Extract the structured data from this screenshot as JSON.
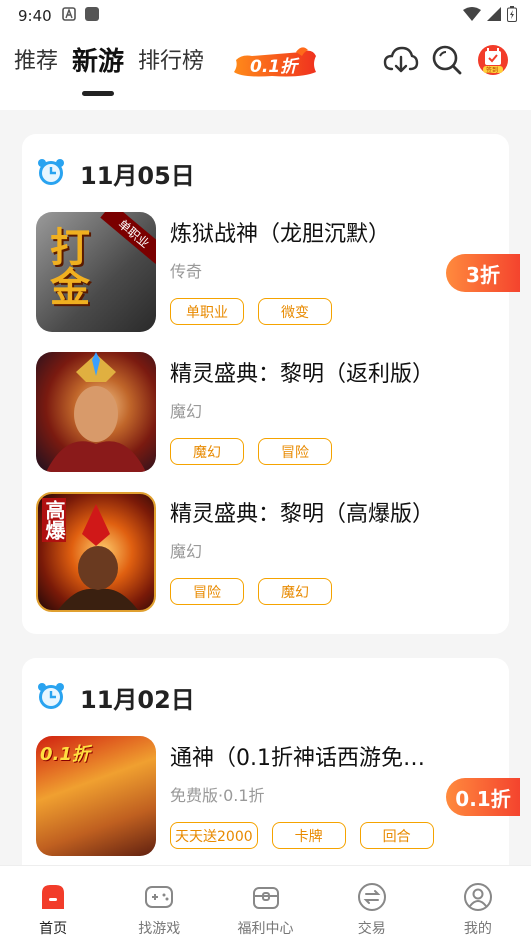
{
  "status_bar": {
    "time": "9:40"
  },
  "header": {
    "tabs": [
      {
        "label": "推荐",
        "active": false
      },
      {
        "label": "新游",
        "active": true
      },
      {
        "label": "排行榜",
        "active": false
      }
    ],
    "promo_label": "0.1折",
    "signin_label": "签到",
    "icons": [
      "download-cloud-icon",
      "search-icon",
      "signin-calendar-icon"
    ]
  },
  "sections": [
    {
      "date": "11月05日",
      "games": [
        {
          "name": "炼狱战神（龙胆沉默）",
          "genre": "传奇",
          "tags": [
            "单职业",
            "微变"
          ],
          "discount": "3折",
          "thumb_text": "打金",
          "thumb_ribbon": "单职业"
        },
        {
          "name": "精灵盛典：黎明（返利版）",
          "genre": "魔幻",
          "tags": [
            "魔幻",
            "冒险"
          ],
          "discount": "",
          "thumb_text": "",
          "thumb_ribbon": ""
        },
        {
          "name": "精灵盛典：黎明（高爆版）",
          "genre": "魔幻",
          "tags": [
            "冒险",
            "魔幻"
          ],
          "discount": "",
          "thumb_text": "高爆",
          "thumb_ribbon": ""
        }
      ]
    },
    {
      "date": "11月02日",
      "games": [
        {
          "name": "通神（0.1折神话西游免…",
          "genre": "免费版·0.1折",
          "tags": [
            "天天送2000",
            "卡牌",
            "回合"
          ],
          "discount": "0.1折",
          "thumb_text": "0.1折",
          "thumb_ribbon": ""
        }
      ]
    }
  ],
  "bottom_nav": [
    {
      "label": "首页",
      "icon": "home-icon",
      "active": true
    },
    {
      "label": "找游戏",
      "icon": "gamepad-icon",
      "active": false
    },
    {
      "label": "福利中心",
      "icon": "gift-box-icon",
      "active": false
    },
    {
      "label": "交易",
      "icon": "exchange-icon",
      "active": false
    },
    {
      "label": "我的",
      "icon": "profile-icon",
      "active": false
    }
  ],
  "colors": {
    "accent": "#f4442e",
    "tag": "#f5a300",
    "brand_dark": "#222222"
  }
}
